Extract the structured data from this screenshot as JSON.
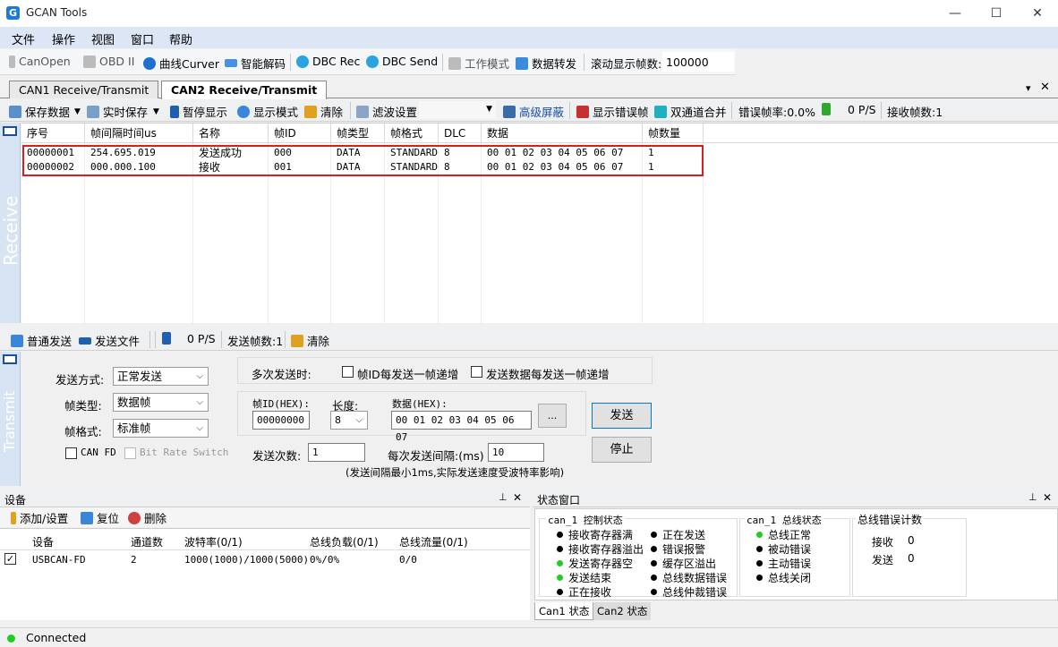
{
  "window": {
    "title": "GCAN Tools",
    "minimize": "—",
    "maximize": "☐",
    "close": "✕"
  },
  "menu": [
    "文件",
    "操作",
    "视图",
    "窗口",
    "帮助"
  ],
  "toolbar": {
    "canopen": "CanOpen",
    "obd": "OBD II",
    "curve": "曲线Curver",
    "decode": "智能解码",
    "dbc_rec": "DBC Rec",
    "dbc_send": "DBC Send",
    "work_mode": "工作模式",
    "forward": "数据转发",
    "scroll_label": "滚动显示帧数:",
    "scroll_value": "100000"
  },
  "tabs": {
    "tab1": "CAN1 Receive/Transmit",
    "tab2": "CAN2 Receive/Transmit",
    "pin": "▾",
    "close": "✕"
  },
  "recv_toolbar": {
    "save": "保存数据",
    "realtime": "实时保存",
    "pause": "暂停显示",
    "display_mode": "显示模式",
    "clear": "清除",
    "filter": "滤波设置",
    "adv_mask": "高级屏蔽",
    "show_err": "显示错误帧",
    "merge": "双通道合并",
    "err_rate": "错误帧率:0.0%",
    "rate": "0 P/S",
    "recv_count": "接收帧数:1"
  },
  "receive_label": "Receive",
  "recv_table": {
    "headers": [
      "序号",
      "帧间隔时间us",
      "名称",
      "帧ID",
      "帧类型",
      "帧格式",
      "DLC",
      "数据",
      "帧数量"
    ],
    "rows": [
      [
        "00000001",
        "254.695.019",
        "发送成功",
        "000",
        "DATA",
        "STANDARD",
        "8",
        "00 01 02 03 04 05 06 07",
        "1"
      ],
      [
        "00000002",
        "000.000.100",
        "接收",
        "001",
        "DATA",
        "STANDARD",
        "8",
        "00 01 02 03 04 05 06 07",
        "1"
      ]
    ]
  },
  "send_toolbar": {
    "normal": "普通发送",
    "file": "发送文件",
    "rate": "0 P/S",
    "send_count": "发送帧数:1",
    "clear": "清除"
  },
  "transmit_label": "Transmit",
  "send_form": {
    "mode_label": "发送方式:",
    "mode_value": "正常发送",
    "type_label": "帧类型:",
    "type_value": "数据帧",
    "format_label": "帧格式:",
    "format_value": "标准帧",
    "canfd": "CAN FD",
    "brs": "Bit Rate Switch",
    "multi_label": "多次发送时:",
    "id_inc": "帧ID每发送一帧递增",
    "data_inc": "发送数据每发送一帧递增",
    "id_label": "帧ID(HEX):",
    "id_value": "00000000",
    "len_label": "长度:",
    "len_value": "8",
    "data_label": "数据(HEX):",
    "data_value": "00 01 02 03 04 05 06 07",
    "more": "...",
    "times_label": "发送次数:",
    "times_value": "1",
    "interval_label": "每次发送间隔:(ms)",
    "interval_value": "10",
    "note": "(发送间隔最小1ms,实际发送速度受波特率影响)",
    "send_btn": "发送",
    "stop_btn": "停止"
  },
  "device": {
    "title": "设备",
    "add": "添加/设置",
    "reset": "复位",
    "delete": "删除",
    "headers": [
      "设备",
      "通道数",
      "波特率(0/1)",
      "总线负载(0/1)",
      "总线流量(0/1)"
    ],
    "rows": [
      [
        "USBCAN-FD",
        "2",
        "1000(1000)/1000(5000)",
        "0%/0%",
        "0/0"
      ]
    ]
  },
  "status": {
    "title": "状态窗口",
    "ctrl_title": "can_1 控制状态",
    "ctrl_col1": [
      "接收寄存器满",
      "接收寄存器溢出",
      "发送寄存器空",
      "发送结束",
      "正在接收"
    ],
    "ctrl_col2": [
      "正在发送",
      "错误报警",
      "缓存区溢出",
      "总线数据错误",
      "总线仲裁错误"
    ],
    "bus_title": "can_1 总线状态",
    "bus_items": [
      "总线正常",
      "被动错误",
      "主动错误",
      "总线关闭"
    ],
    "err_title": "总线错误计数",
    "recv_label": "接收",
    "recv_value": "0",
    "send_label": "发送",
    "send_value": "0",
    "tab1": "Can1 状态",
    "tab2": "Can2 状态"
  },
  "statusbar": {
    "text": "Connected"
  },
  "colors": {
    "accent": "#1e7ad6",
    "highlight": "#d62020",
    "ok": "#22cc22"
  }
}
